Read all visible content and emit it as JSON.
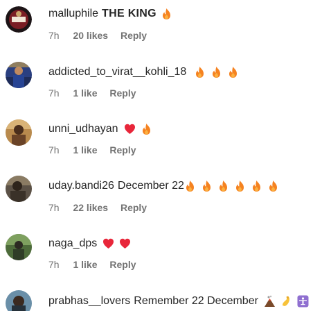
{
  "comments": [
    {
      "username": "malluphile",
      "text": "THE KING",
      "text_bold": true,
      "emojis": [
        "fire-emoji"
      ],
      "time": "7h",
      "likes": "20 likes",
      "reply": "Reply"
    },
    {
      "username": "addicted_to_virat__kohli_18",
      "text": "",
      "emojis": [
        "fire-emoji",
        "fire-emoji",
        "fire-emoji"
      ],
      "time": "7h",
      "likes": "1 like",
      "reply": "Reply"
    },
    {
      "username": "unni_udhayan",
      "text": "",
      "emojis": [
        "red-heart-emoji",
        "fire-emoji"
      ],
      "time": "7h",
      "likes": "1 like",
      "reply": "Reply"
    },
    {
      "username": "uday.bandi26",
      "text": "December 22",
      "emojis": [
        "fire-emoji",
        "fire-emoji",
        "fire-emoji",
        "fire-emoji",
        "fire-emoji",
        "fire-emoji"
      ],
      "time": "7h",
      "likes": "22 likes",
      "reply": "Reply"
    },
    {
      "username": "naga_dps",
      "text": "",
      "emojis": [
        "red-heart-emoji",
        "red-heart-emoji"
      ],
      "time": "7h",
      "likes": "1 like",
      "reply": "Reply"
    },
    {
      "username": "prabhas__lovers",
      "text": "Remember 22 December",
      "emojis": [
        "volcano-emoji",
        "flexed-biceps-emoji",
        "person-lifting-weights-emoji"
      ],
      "time": "",
      "likes": "",
      "reply": ""
    }
  ],
  "colors": {
    "text": "#262626",
    "secondary": "#737373",
    "fire": "#f58220",
    "heart": "#e8263a"
  }
}
